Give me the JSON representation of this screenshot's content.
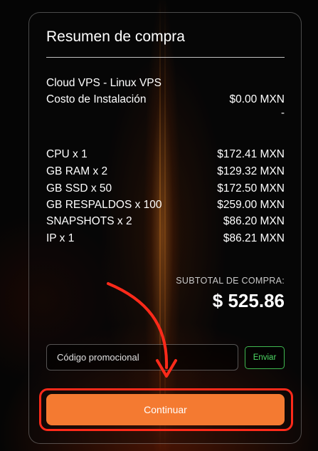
{
  "summary": {
    "title": "Resumen de compra",
    "product": "Cloud VPS - Linux VPS",
    "setup_label": "Costo de Instalación",
    "setup_value": "$0.00 MXN",
    "setup_extra": "-"
  },
  "items": [
    {
      "label": "CPU x 1",
      "price": "$172.41 MXN"
    },
    {
      "label": "GB RAM x 2",
      "price": "$129.32 MXN"
    },
    {
      "label": "GB SSD x 50",
      "price": "$172.50 MXN"
    },
    {
      "label": "GB RESPALDOS x 100",
      "price": "$259.00 MXN"
    },
    {
      "label": "SNAPSHOTS x 2",
      "price": "$86.20 MXN"
    },
    {
      "label": "IP x 1",
      "price": "$86.21 MXN"
    }
  ],
  "subtotal": {
    "label": "SUBTOTAL DE COMPRA:",
    "value": "$ 525.86"
  },
  "promo": {
    "placeholder": "Código promocional",
    "button": "Enviar"
  },
  "continue_label": "Continuar",
  "colors": {
    "accent": "#f47a31",
    "success": "#4cd964",
    "highlight": "#ff2a1a"
  }
}
